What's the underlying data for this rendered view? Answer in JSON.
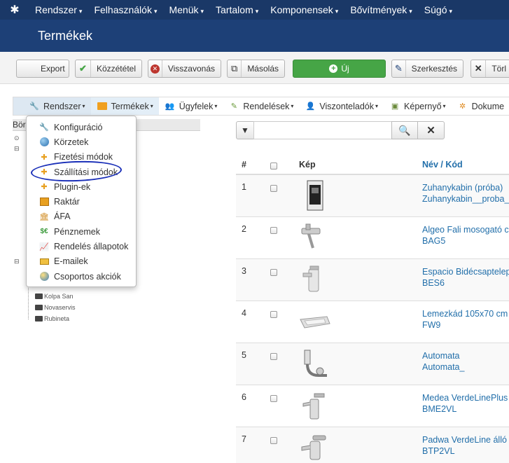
{
  "topnav": {
    "items": [
      {
        "label": "Rendszer"
      },
      {
        "label": "Felhasználók"
      },
      {
        "label": "Menük"
      },
      {
        "label": "Tartalom"
      },
      {
        "label": "Komponensek"
      },
      {
        "label": "Bővítmények"
      },
      {
        "label": "Súgó"
      }
    ]
  },
  "page_title": "Termékek",
  "toolbar": {
    "export": "Export",
    "publish": "Közzététel",
    "unpublish": "Visszavonás",
    "copy": "Másolás",
    "new": "Új",
    "edit": "Szerkesztés",
    "delete": "Törl"
  },
  "subnav": {
    "items": [
      {
        "label": "Rendszer"
      },
      {
        "label": "Termékek"
      },
      {
        "label": "Ügyfelek"
      },
      {
        "label": "Rendelések"
      },
      {
        "label": "Viszonteladók"
      },
      {
        "label": "Képernyő"
      },
      {
        "label": "Dokume"
      }
    ]
  },
  "dropdown": {
    "items": [
      {
        "label": "Konfiguráció",
        "icon": "wrench-icon"
      },
      {
        "label": "Körzetek",
        "icon": "globe-icon"
      },
      {
        "label": "Fizetési módok",
        "icon": "puzzle-icon"
      },
      {
        "label": "Szállítási módok",
        "icon": "puzzle-icon"
      },
      {
        "label": "Plugin-ek",
        "icon": "puzzle-icon"
      },
      {
        "label": "Raktár",
        "icon": "warehouse-icon"
      },
      {
        "label": "ÁFA",
        "icon": "bank-icon"
      },
      {
        "label": "Pénznemek",
        "icon": "currency-icon"
      },
      {
        "label": "Rendelés állapotok",
        "icon": "chart-icon"
      },
      {
        "label": "E-mailek",
        "icon": "envelope-icon"
      },
      {
        "label": "Csoportos akciók",
        "icon": "globe-action-icon"
      }
    ]
  },
  "tree": {
    "title": "Bör",
    "items": [
      "Kolpa San",
      "Novaservis",
      "Rubineta"
    ]
  },
  "filter": {
    "placeholder": ""
  },
  "table": {
    "headers": {
      "num": "#",
      "image": "Kép",
      "name": "Név / Kód"
    },
    "rows": [
      {
        "num": "1",
        "name": "Zuhanykabin (próba)",
        "code": "Zuhanykabin__proba_"
      },
      {
        "num": "2",
        "name": "Algeo Fali mosogató csa",
        "code": "BAG5"
      },
      {
        "num": "3",
        "name": "Espacio Bidécsaptelep",
        "code": "BES6"
      },
      {
        "num": "4",
        "name": "Lemezkád 105x70 cm",
        "code": "FW9"
      },
      {
        "num": "5",
        "name": "Automata",
        "code": "Automata_"
      },
      {
        "num": "6",
        "name": "Medea VerdeLinePlus M",
        "code": "BME2VL"
      },
      {
        "num": "7",
        "name": "Padwa VerdeLine álló m",
        "code": "BTP2VL"
      }
    ]
  },
  "colors": {
    "topnav_bg": "#1a3867",
    "title_bg": "#1d4077",
    "new_button": "#46a546",
    "link": "#226faa",
    "annotation": "#1a2fb8"
  }
}
